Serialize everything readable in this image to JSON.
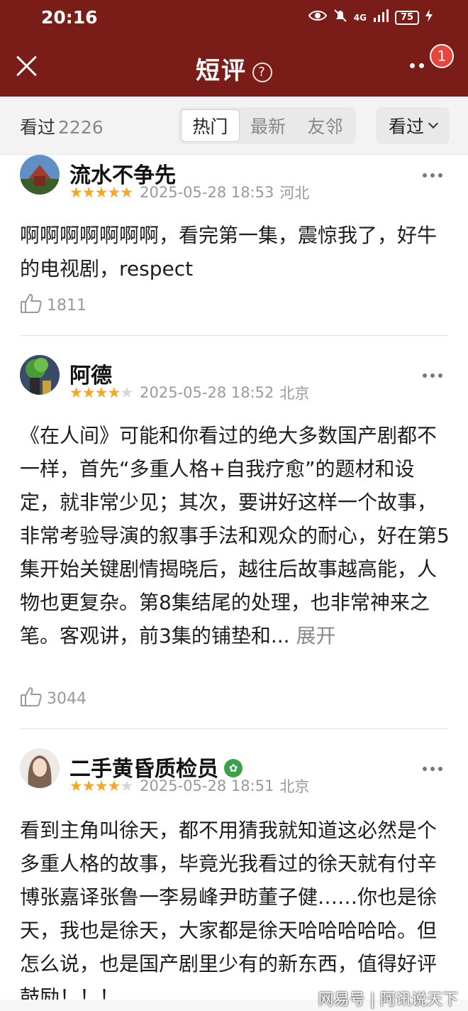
{
  "status_bar": {
    "time": "20:16",
    "network": "4G",
    "battery": "75"
  },
  "header": {
    "title": "短评",
    "help": "?",
    "notification_count": "1"
  },
  "filter": {
    "watched_label": "看过",
    "watched_count": "2226",
    "tabs": [
      "热门",
      "最新",
      "友邻"
    ],
    "active_tab": "热门",
    "dropdown_label": "看过"
  },
  "reviews": [
    {
      "username": "流水不争先",
      "rating": 5,
      "date": "2025-05-28 18:53",
      "location": "河北",
      "content": "啊啊啊啊啊啊啊，看完第一集，震惊我了，好牛的电视剧，respect",
      "likes": "1811"
    },
    {
      "username": "阿德",
      "rating": 4,
      "date": "2025-05-28 18:52",
      "location": "北京",
      "content": "《在人间》可能和你看过的绝大多数国产剧都不一样，首先“多重人格+自我疗愈”的题材和设定，就非常少见；其次，要讲好这样一个故事，非常考验导演的叙事手法和观众的耐心，好在第5集开始关键剧情揭晓后，越往后故事越高能，人物也更复杂。第8集结尾的处理，也非常神来之笔。客观讲，前3集的铺垫和...",
      "expand": "展开",
      "likes": "3044"
    },
    {
      "username": "二手黄昏质检员",
      "rating": 4,
      "date": "2025-05-28 18:51",
      "location": "北京",
      "content": "看到主角叫徐天，都不用猜我就知道这必然是个多重人格的故事，毕竟光我看过的徐天就有付辛博张嘉译张鲁一李易峰尹昉董子健……你也是徐天，我也是徐天，大家都是徐天哈哈哈哈哈。但怎么说，也是国产剧里少有的新东西，值得好评鼓励！！！"
    }
  ],
  "watermark": "网易号 | 阿讯说天下"
}
